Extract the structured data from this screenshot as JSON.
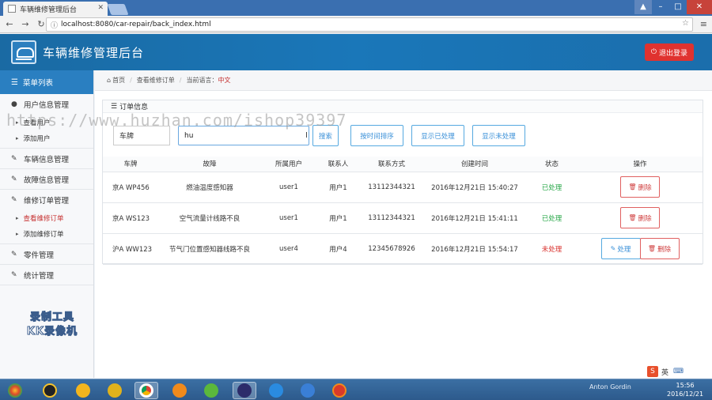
{
  "browser": {
    "tab_title": "车辆维修管理后台",
    "url": "localhost:8080/car-repair/back_index.html"
  },
  "header": {
    "title": "车辆维修管理后台",
    "logout_label": "退出登录"
  },
  "sidebar": {
    "head": "菜单列表",
    "groups": [
      {
        "label": "用户信息管理",
        "icon": "user-icon",
        "subs": [
          "查看用户",
          "添加用户"
        ]
      },
      {
        "label": "车辆信息管理",
        "icon": "edit-icon"
      },
      {
        "label": "故障信息管理",
        "icon": "edit-icon"
      },
      {
        "label": "维修订单管理",
        "icon": "edit-icon",
        "subs": [
          "查看维修订单",
          "添加维修订单"
        ]
      },
      {
        "label": "零件管理",
        "icon": "edit-icon"
      },
      {
        "label": "统计管理",
        "icon": "edit-icon"
      }
    ]
  },
  "recorder": {
    "line1": "录制工具",
    "line2": "KK录像机"
  },
  "breadcrumb": {
    "home": "首页",
    "page": "查看维修订单",
    "current_prefix": "当前语言：",
    "current_lang": "中文"
  },
  "panel": {
    "title": "订单信息"
  },
  "toolbar": {
    "filter_select": "车牌",
    "search_value": "hu",
    "search_btn": "搜索",
    "sort_btn": "按时间排序",
    "show_done_btn": "显示已处理",
    "show_pending_btn": "显示未处理"
  },
  "table": {
    "headers": [
      "车牌",
      "故障",
      "所属用户",
      "联系人",
      "联系方式",
      "创建时间",
      "状态",
      "操作"
    ],
    "rows": [
      {
        "plate": "京A WP456",
        "fault": "燃油温度感知器",
        "user": "user1",
        "contact": "用户1",
        "phone": "13112344321",
        "time": "2016年12月21日 15:40:27",
        "status": "已处理",
        "handle": "",
        "delete": "删除"
      },
      {
        "plate": "京A WS123",
        "fault": "空气流量计线路不良",
        "user": "user1",
        "contact": "用户1",
        "phone": "13112344321",
        "time": "2016年12月21日 15:41:11",
        "status": "已处理",
        "handle": "",
        "delete": "删除"
      },
      {
        "plate": "沪A WW123",
        "fault": "节气门位置感知器线路不良",
        "user": "user4",
        "contact": "用户4",
        "phone": "12345678926",
        "time": "2016年12月21日 15:54:17",
        "status": "未处理",
        "handle": "处理",
        "delete": "删除"
      }
    ]
  },
  "watermark": "https://www.huzhan.com/ishop39397",
  "ime": {
    "lang": "英"
  },
  "taskbar": {
    "time": "15:56",
    "date": "2016/12/21",
    "tray_user": "Anton Gordin"
  },
  "colors": {
    "header_blue": "#1a77b9",
    "logout_red": "#e0322f",
    "status_done": "#2aa84a",
    "status_pending": "#d9302c",
    "accent_blue": "#3a90d8"
  }
}
